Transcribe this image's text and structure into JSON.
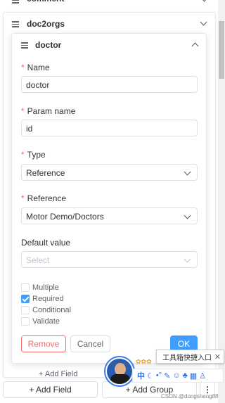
{
  "top_partial_label": "comment",
  "section": {
    "title": "doc2orgs"
  },
  "field": {
    "title": "doctor",
    "name_label": "Name",
    "name_value": "doctor",
    "param_label": "Param name",
    "param_value": "id",
    "type_label": "Type",
    "type_value": "Reference",
    "reference_label": "Reference",
    "reference_value": "Motor Demo/Doctors",
    "default_label": "Default value",
    "default_placeholder": "Select",
    "checkboxes": [
      {
        "label": "Multiple",
        "checked": false
      },
      {
        "label": "Required",
        "checked": true
      },
      {
        "label": "Conditional",
        "checked": false
      },
      {
        "label": "Validate",
        "checked": false
      }
    ],
    "remove_label": "Remove",
    "cancel_label": "Cancel",
    "ok_label": "OK"
  },
  "inner_add_field": "+ Add Field",
  "bottom": {
    "add_field": "+ Add Field",
    "add_group": "+ Add Group",
    "more": "⋮"
  },
  "toolbar": {
    "tooltip": "工具箱快捷入口",
    "ime_char": "中",
    "watermark": "CSDN @dongsheng88"
  },
  "colors": {
    "primary": "#409eff",
    "danger": "#f56c6c",
    "required": "#f56c6c"
  }
}
